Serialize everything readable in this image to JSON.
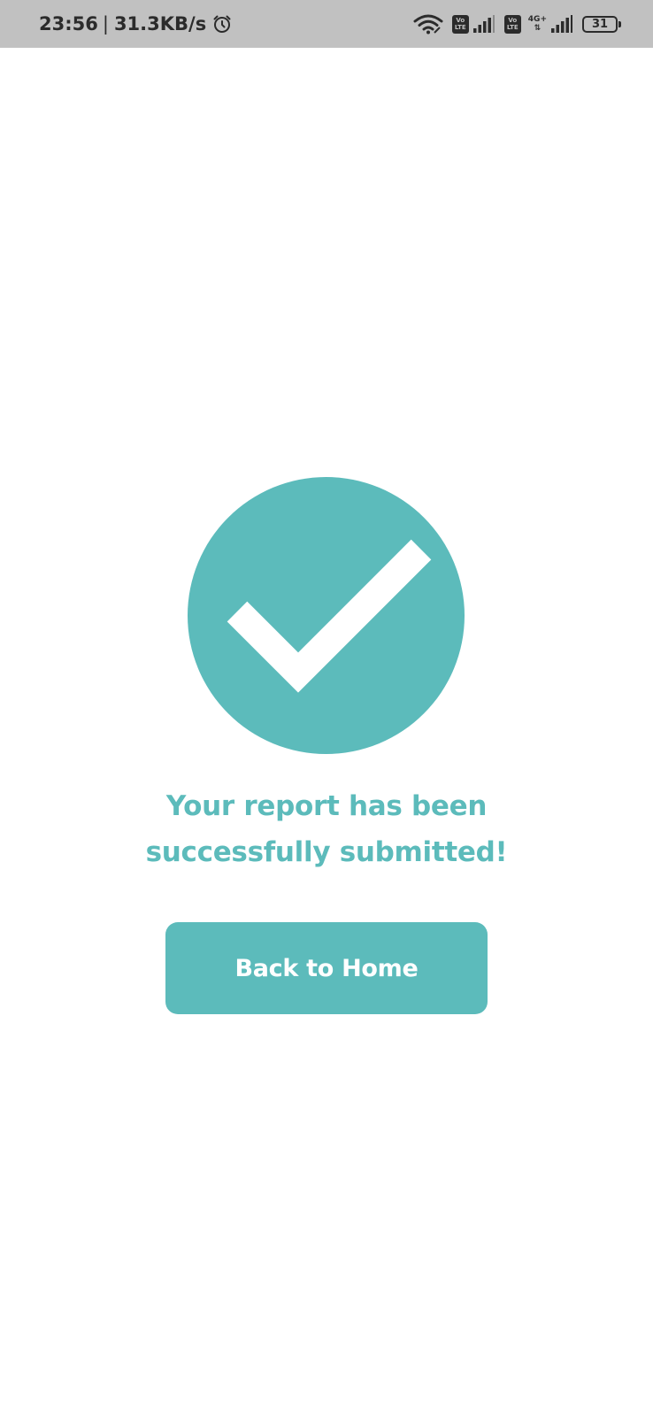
{
  "status_bar": {
    "time": "23:56",
    "separator": "|",
    "net_speed": "31.3KB/s",
    "sim1_volte_top": "Vo",
    "sim1_volte_bottom": "LTE",
    "sim2_volte_top": "Vo",
    "sim2_volte_bottom": "LTE",
    "sim2_network_type": "4G+",
    "sim2_activity": "⇅",
    "battery_level": "31",
    "icons": [
      "alarm-clock-icon",
      "wifi-icon",
      "signal-icon",
      "battery-icon"
    ]
  },
  "main": {
    "icon": "checkmark-circle-icon",
    "message_line1": "Your report has been",
    "message_line2": "successfully submitted!",
    "button_label": "Back to Home"
  },
  "colors": {
    "accent": "#5cbbbb",
    "status_bar_bg": "#c1c1c1",
    "background": "#ffffff"
  }
}
